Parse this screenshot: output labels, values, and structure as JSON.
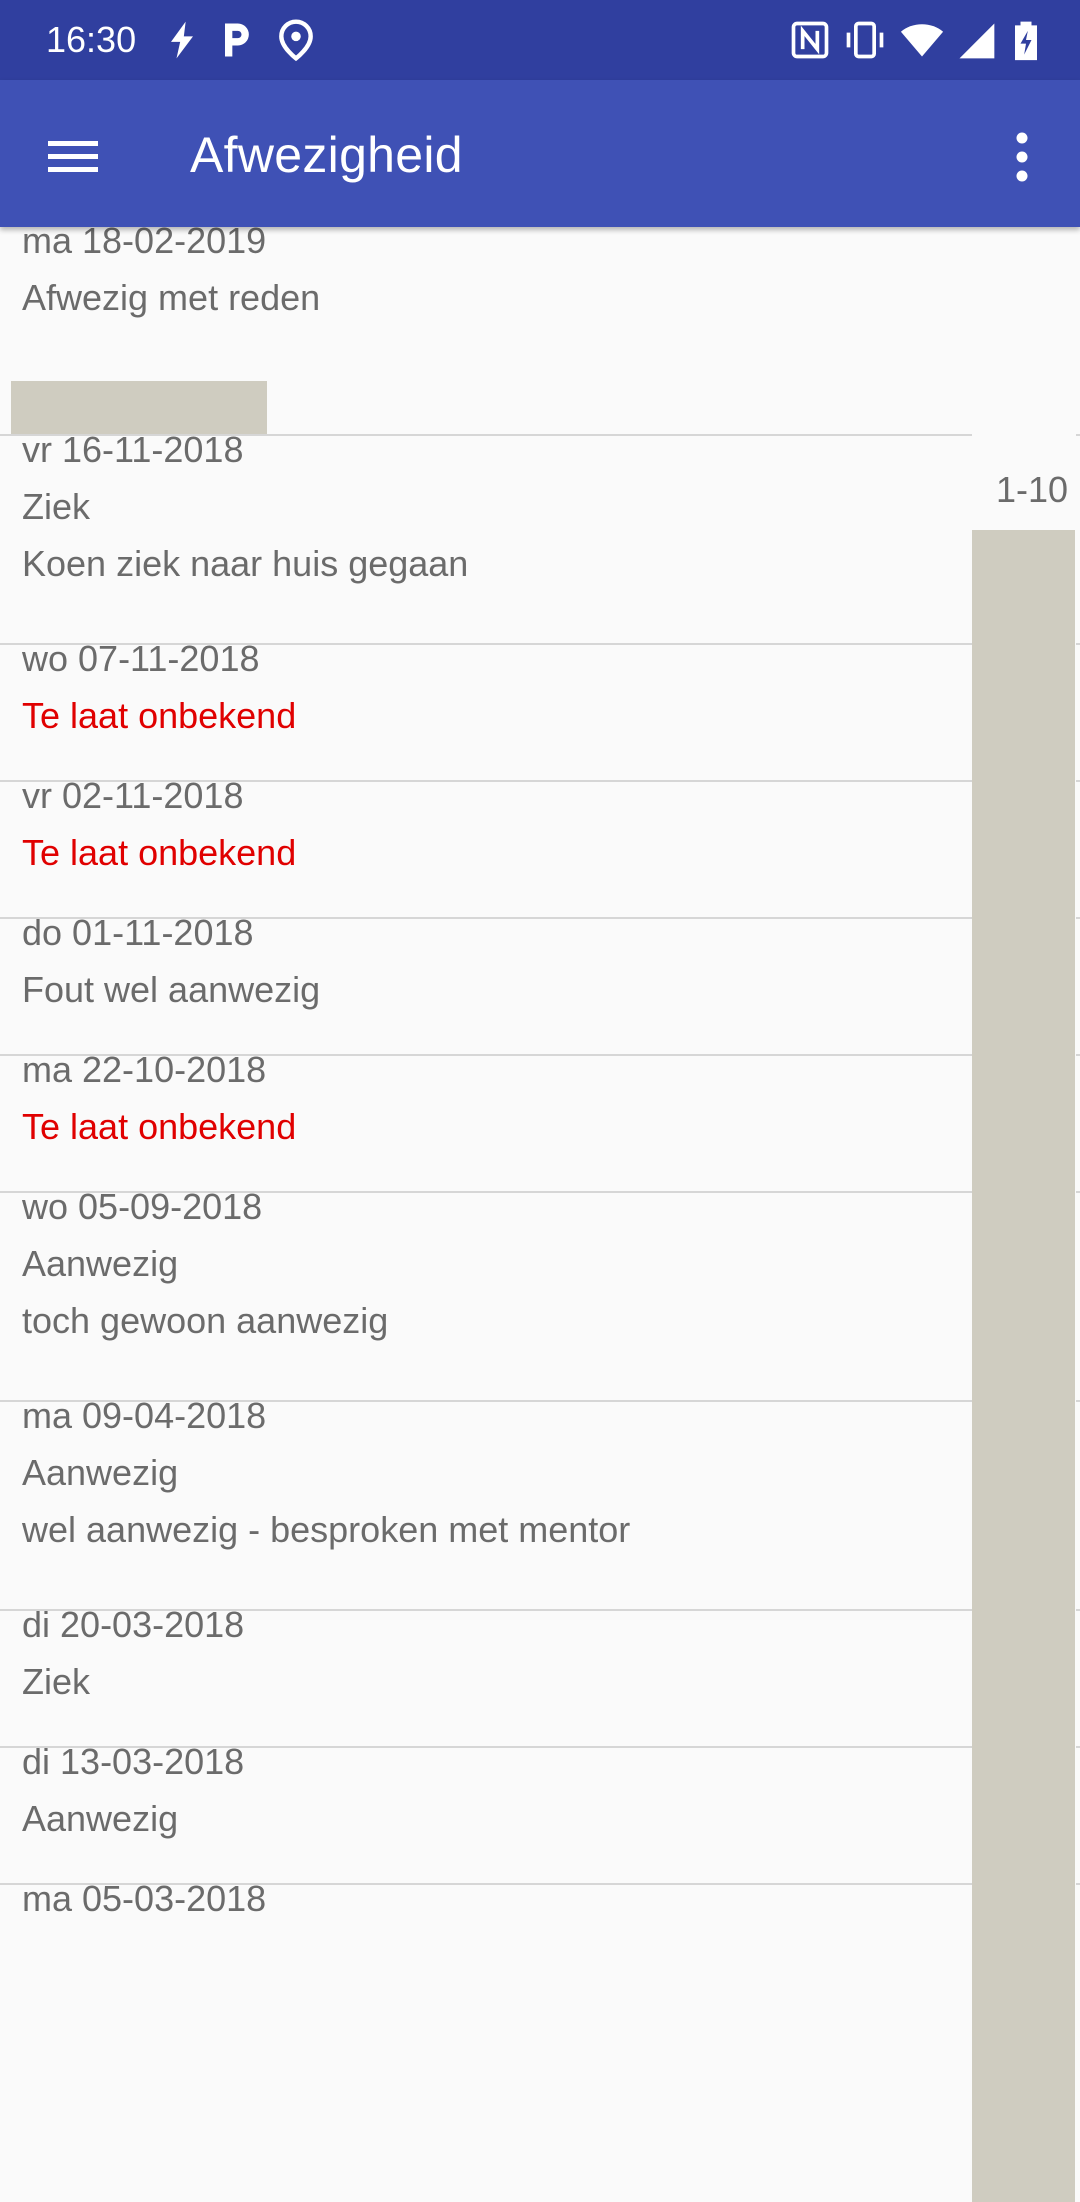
{
  "status_bar": {
    "time": "16:30",
    "left_icons": [
      "lightning-icon",
      "parking-icon",
      "location-icon"
    ],
    "right_icons": [
      "nfc-icon",
      "vibrate-icon",
      "wifi-icon",
      "signal-icon",
      "battery-charging-icon"
    ]
  },
  "toolbar": {
    "title": "Afwezigheid",
    "menu_icon": "hamburger-menu-icon",
    "overflow_icon": "more-vertical-icon"
  },
  "lessons_label": "1-10",
  "entries": [
    {
      "date": "ma 18-02-2019",
      "type": "Afwezig met reden",
      "type_color": "#6b6b6b",
      "note": ""
    },
    {
      "date": "vr 16-11-2018",
      "type": "Ziek",
      "type_color": "#6b6b6b",
      "note": "Koen ziek naar huis gegaan"
    },
    {
      "date": "wo 07-11-2018",
      "type": "Te laat onbekend",
      "type_color": "#e00000",
      "note": ""
    },
    {
      "date": "vr 02-11-2018",
      "type": "Te laat onbekend",
      "type_color": "#e00000",
      "note": ""
    },
    {
      "date": "do 01-11-2018",
      "type": "Fout wel aanwezig",
      "type_color": "#6b6b6b",
      "note": ""
    },
    {
      "date": "ma 22-10-2018",
      "type": "Te laat onbekend",
      "type_color": "#e00000",
      "note": ""
    },
    {
      "date": "wo 05-09-2018",
      "type": "Aanwezig",
      "type_color": "#6b6b6b",
      "note": "toch gewoon aanwezig"
    },
    {
      "date": "ma 09-04-2018",
      "type": "Aanwezig",
      "type_color": "#6b6b6b",
      "note": "wel aanwezig - besproken met mentor"
    },
    {
      "date": "di 20-03-2018",
      "type": "Ziek",
      "type_color": "#6b6b6b",
      "note": ""
    },
    {
      "date": "di 13-03-2018",
      "type": "Aanwezig",
      "type_color": "#6b6b6b",
      "note": ""
    },
    {
      "date": "ma 05-03-2018",
      "type": "",
      "type_color": "#6b6b6b",
      "note": ""
    }
  ],
  "colors": {
    "status_bar": "#303f9f",
    "toolbar": "#3f51b5",
    "late_text": "#e00000",
    "grey_text": "#6b6b6b",
    "marker": "#cfccc0"
  }
}
